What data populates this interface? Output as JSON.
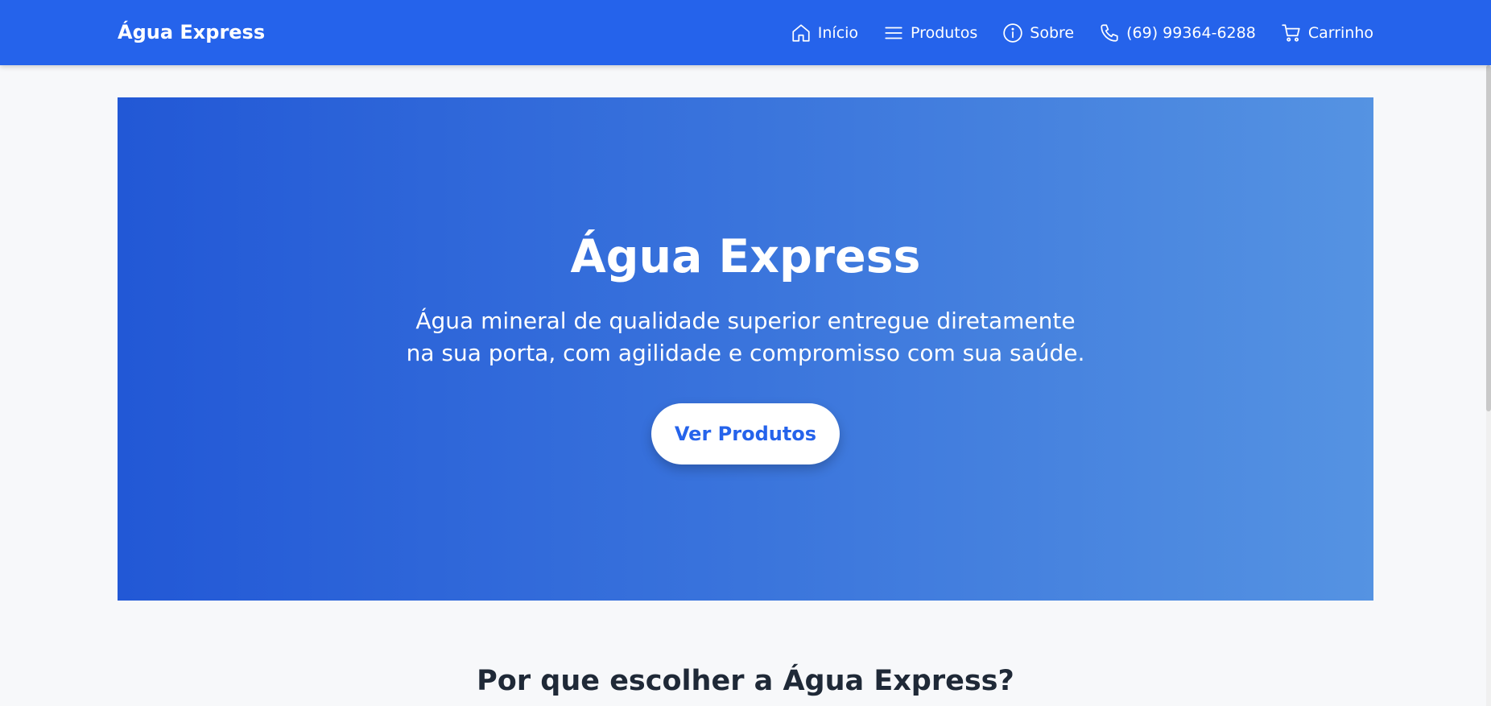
{
  "navbar": {
    "brand": "Água Express",
    "items": [
      {
        "label": "Início",
        "icon": "home-icon"
      },
      {
        "label": "Produtos",
        "icon": "menu-icon"
      },
      {
        "label": "Sobre",
        "icon": "info-icon"
      },
      {
        "label": "(69) 99364-6288",
        "icon": "phone-icon"
      },
      {
        "label": "Carrinho",
        "icon": "cart-icon"
      }
    ]
  },
  "hero": {
    "title": "Água Express",
    "subtitle": "Água mineral de qualidade superior entregue diretamente na sua porta, com agilidade e compromisso com sua saúde.",
    "button_label": "Ver Produtos"
  },
  "features": {
    "title": "Por que escolher a Água Express?"
  },
  "colors": {
    "primary": "#2563eb",
    "hero_gradient_start": "#2258d6",
    "hero_gradient_end": "#5593e2",
    "background": "#f7f8fa",
    "heading_text": "#1f2937"
  }
}
